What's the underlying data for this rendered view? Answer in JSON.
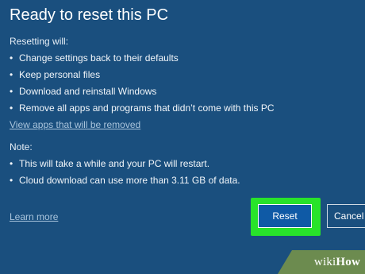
{
  "dialog": {
    "title": "Ready to reset this PC",
    "resetting_label": "Resetting will:",
    "resetting_items": [
      "Change settings back to their defaults",
      "Keep personal files",
      "Download and reinstall Windows",
      "Remove all apps and programs that didn’t come with this PC"
    ],
    "view_apps_link": "View apps that will be removed",
    "note_label": "Note:",
    "note_items": [
      "This will take a while and your PC will restart.",
      "Cloud download can use more than 3.11 GB of data."
    ],
    "learn_more_link": "Learn more",
    "reset_button": "Reset",
    "cancel_button": "Cancel",
    "bullet": "•"
  },
  "watermark": {
    "prefix": "wiki",
    "suffix": "How"
  },
  "colors": {
    "background": "#1a4f7e",
    "highlight": "#28e32a",
    "reset_button": "#0f5aa6",
    "link": "#a9c4dc"
  }
}
